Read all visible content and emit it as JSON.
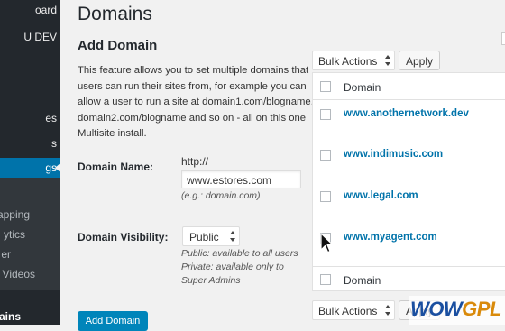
{
  "sidebar": {
    "items": [
      {
        "label": "oard"
      },
      {
        "label": "U DEV"
      },
      {
        "label": "es"
      },
      {
        "label": "s"
      },
      {
        "label": "gs"
      }
    ],
    "submenu": [
      {
        "label": "apping"
      },
      {
        "label": "ytics"
      },
      {
        "label": "er"
      },
      {
        "label": "V Videos"
      }
    ],
    "bottom": {
      "label": "ains"
    }
  },
  "page": {
    "title": "Domains"
  },
  "add_domain": {
    "title": "Add Domain",
    "description": "This feature allows you to set multiple domains that users can run their sites from, for example you can allow a user to run a site at domain1.com/blogname, domain2.com/blogname and so on - all on this one Multisite install.",
    "domain_name_label": "Domain Name:",
    "http_prefix": "http://",
    "domain_value": "www.estores.com",
    "domain_hint": "(e.g.: domain.com)",
    "visibility_label": "Domain Visibility:",
    "visibility_value": "Public",
    "visibility_note_1": "Public: available to all users",
    "visibility_note_2": "Private: available only to",
    "visibility_note_3": "Super Admins",
    "button": "Add Domain"
  },
  "table": {
    "bulk_actions": "Bulk Actions",
    "apply": "Apply",
    "header": "Domain",
    "footer": "Domain",
    "rows": [
      "www.anothernetwork.dev",
      "www.indimusic.com",
      "www.legal.com",
      "www.myagent.com"
    ]
  },
  "watermark": {
    "part1": "WOW",
    "part2": "GPL"
  },
  "colors": {
    "accent": "#0073aa",
    "sidebar": "#23282d",
    "button": "#0085ba"
  }
}
